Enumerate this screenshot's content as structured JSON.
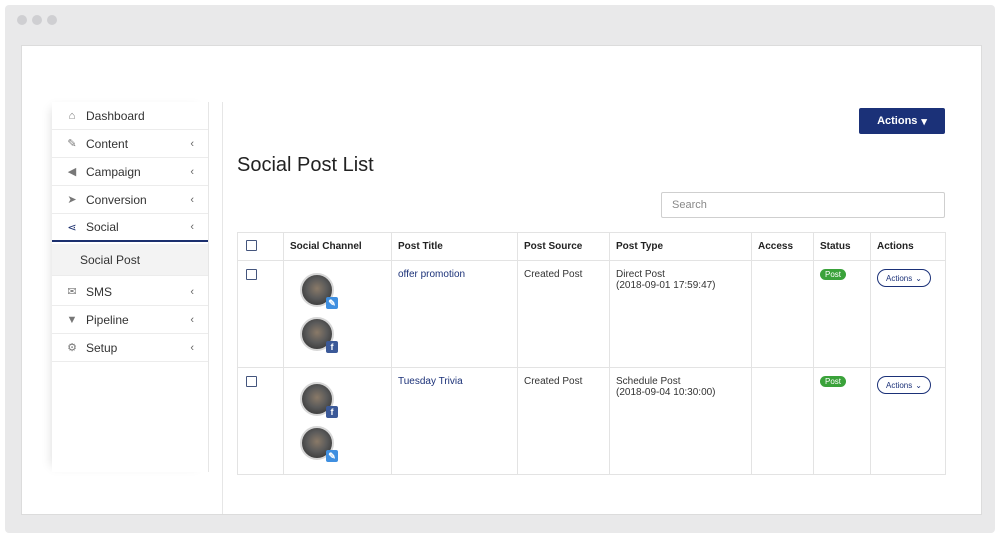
{
  "sidebar": {
    "items": [
      {
        "label": "Dashboard",
        "icon": "home-icon",
        "glyph": "⌂",
        "chevron": false
      },
      {
        "label": "Content",
        "icon": "edit-icon",
        "glyph": "✎",
        "chevron": true
      },
      {
        "label": "Campaign",
        "icon": "megaphone-icon",
        "glyph": "📢",
        "chevron": true
      },
      {
        "label": "Conversion",
        "icon": "cursor-icon",
        "glyph": "➤",
        "chevron": true
      },
      {
        "label": "Social",
        "icon": "share-icon",
        "glyph": "⋖",
        "chevron": true,
        "active": true
      },
      {
        "label": "SMS",
        "icon": "envelope-icon",
        "glyph": "✉",
        "chevron": true
      },
      {
        "label": "Pipeline",
        "icon": "filter-icon",
        "glyph": "▼",
        "chevron": true
      },
      {
        "label": "Setup",
        "icon": "gear-icon",
        "glyph": "⚙",
        "chevron": true
      }
    ],
    "sub_item": "Social Post",
    "chevron_glyph": "‹"
  },
  "header": {
    "actions_label": "Actions",
    "actions_caret": "▾"
  },
  "page_title": "Social Post List",
  "search": {
    "placeholder": "Search",
    "value": ""
  },
  "table": {
    "columns": [
      "Social Channel",
      "Post Title",
      "Post Source",
      "Post Type",
      "Access",
      "Status",
      "Actions"
    ],
    "rows": [
      {
        "channels": [
          "pencil-icon",
          "facebook-icon"
        ],
        "channel_glyphs": [
          "✎",
          "f"
        ],
        "title": "offer promotion",
        "source": "Created Post",
        "type": "Direct Post",
        "type_date": "(2018-09-01 17:59:47)",
        "access": "",
        "status": "Post",
        "action_label": "Actions",
        "action_caret": "⌄"
      },
      {
        "channels": [
          "facebook-icon",
          "pencil-icon"
        ],
        "channel_glyphs": [
          "f",
          "✎"
        ],
        "title": "Tuesday Trivia",
        "source": "Created Post",
        "type": "Schedule Post",
        "type_date": "(2018-09-04 10:30:00)",
        "access": "",
        "status": "Post",
        "action_label": "Actions",
        "action_caret": "⌄"
      }
    ]
  },
  "colors": {
    "primary": "#1b3178",
    "status_green": "#3aa23a",
    "pencil_blue": "#3f8fe0",
    "facebook": "#3b5998"
  }
}
